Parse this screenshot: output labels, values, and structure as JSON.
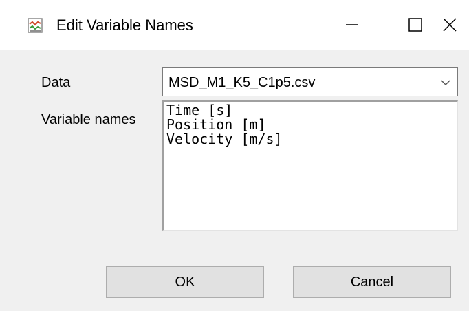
{
  "window": {
    "title": "Edit Variable Names",
    "controls": {
      "minimize": "minimize-icon",
      "maximize": "maximize-icon",
      "close": "close-icon"
    }
  },
  "form": {
    "data_label": "Data",
    "data_value": "MSD_M1_K5_C1p5.csv",
    "variable_names_label": "Variable names",
    "variable_names": [
      "Time [s]",
      "Position [m]",
      "Velocity [m/s]"
    ]
  },
  "buttons": {
    "ok_label": "OK",
    "cancel_label": "Cancel"
  },
  "colors": {
    "window_bg": "#f0f0f0",
    "titlebar_bg": "#ffffff",
    "button_bg": "#e1e1e1",
    "button_border": "#adadad",
    "field_border": "#7a7a7a"
  }
}
